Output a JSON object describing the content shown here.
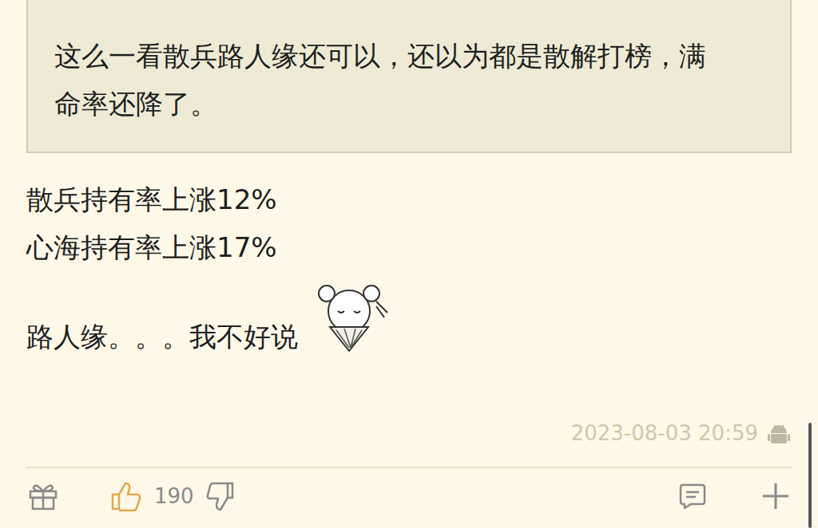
{
  "quote": {
    "lines": [
      "这么一看散兵路人缘还可以，还以为都是散解打榜，满",
      "命率还降了。"
    ]
  },
  "body": {
    "lines": [
      "散兵持有率上涨12%",
      "心海持有率上涨17%"
    ],
    "last_line": "路人缘。。。我不好说"
  },
  "meta": {
    "timestamp": "2023-08-03 20:59"
  },
  "actions": {
    "likes": "190"
  }
}
